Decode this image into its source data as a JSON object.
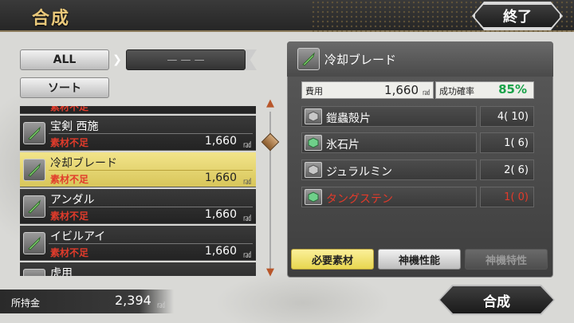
{
  "header": {
    "title": "合成",
    "end_label": "終了"
  },
  "filter": {
    "all_label": "ALL",
    "sort_label": "ソート",
    "category_placeholder": "— — —"
  },
  "list": {
    "partial_top_status": "素材不足",
    "items": [
      {
        "name": "宝剣 西施",
        "status": "素材不足",
        "cost": "1,660",
        "unit": "㎭"
      },
      {
        "name": "冷却ブレード",
        "status": "素材不足",
        "cost": "1,660",
        "unit": "㎭"
      },
      {
        "name": "アンダル",
        "status": "素材不足",
        "cost": "1,660",
        "unit": "㎭"
      },
      {
        "name": "イビルアイ",
        "status": "素材不足",
        "cost": "1,660",
        "unit": "㎭"
      }
    ],
    "partial_bottom_name": "虎用"
  },
  "detail": {
    "title": "冷却ブレード",
    "cost_label": "費用",
    "cost_value": "1,660",
    "cost_unit": "㎭",
    "rate_label": "成功確率",
    "rate_value": "85%",
    "materials": [
      {
        "name": "鎧蟲殻片",
        "qty": "4(  10)",
        "short": false
      },
      {
        "name": "氷石片",
        "qty": "1(   6)",
        "short": false
      },
      {
        "name": "ジュラルミン",
        "qty": "2(   6)",
        "short": false
      },
      {
        "name": "タングステン",
        "qty": "1(   0)",
        "short": true
      }
    ]
  },
  "tabs": {
    "required": "必要素材",
    "performance": "神機性能",
    "trait": "神機特性"
  },
  "footer": {
    "money_label": "所持金",
    "money_value": "2,394",
    "money_unit": "㎭",
    "synth_label": "合成"
  },
  "colors": {
    "accent_gold": "#e9c87a",
    "selected_row": "#f2e48a",
    "shortage_red": "#e23b2b",
    "rate_green": "#1aa34a"
  },
  "icons": {
    "item": "blade-icon",
    "material": "material-chunk-icon"
  }
}
